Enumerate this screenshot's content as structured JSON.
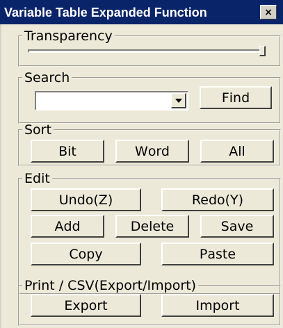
{
  "window": {
    "title": "Variable Table Expanded Function",
    "close_label": "×"
  },
  "transparency": {
    "label": "Transparency",
    "value_percent": 100
  },
  "search": {
    "label": "Search",
    "input_value": "",
    "find": {
      "u": "F",
      "rest": "ind"
    }
  },
  "sort": {
    "label": "Sort",
    "bit": {
      "u": "B",
      "rest": "it"
    },
    "word": {
      "u": "W",
      "rest": "ord"
    },
    "all": {
      "pre": "A",
      "u": "l",
      "rest": "l"
    }
  },
  "edit": {
    "label": "Edit",
    "undo": {
      "pre": "Undo(",
      "u": "Z",
      "post": ")"
    },
    "redo": {
      "pre": "Redo(",
      "u": "Y",
      "post": ")"
    },
    "add": {
      "u": "A",
      "rest": "dd"
    },
    "delete": {
      "u": "D",
      "rest": "elete"
    },
    "save": {
      "u": "S",
      "rest": "ave"
    },
    "copy": {
      "u": "C",
      "rest": "opy"
    },
    "paste": {
      "u": "P",
      "rest": "aste"
    }
  },
  "print_csv": {
    "label": "Print / CSV(Export/Import)",
    "export": {
      "u": "E",
      "rest": "xport"
    },
    "import": {
      "u": "I",
      "rest": "mport"
    }
  }
}
